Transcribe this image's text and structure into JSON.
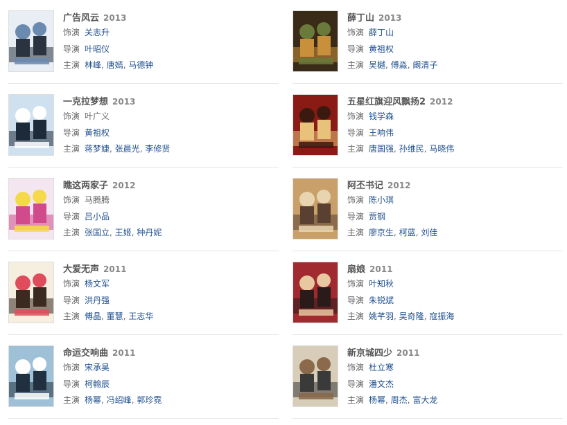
{
  "labels": {
    "role": "饰演",
    "director": "导演",
    "cast": "主演"
  },
  "left": [
    {
      "title": "广告风云",
      "year": "2013",
      "role": "关志升",
      "role_link": true,
      "director": "叶昭仪",
      "cast": [
        "林峰",
        "唐嫣",
        "马德钟"
      ],
      "poster": {
        "bg": "#e8eef3",
        "accent": "#2a3440",
        "hl": "#6a8ab0"
      }
    },
    {
      "title": "一克拉梦想",
      "year": "2013",
      "role": "叶广义",
      "role_link": false,
      "director": "黄祖权",
      "cast": [
        "蒋梦婕",
        "张晨光",
        "李修贤"
      ],
      "poster": {
        "bg": "#cfe0ee",
        "accent": "#1d2a3a",
        "hl": "#ffffff"
      }
    },
    {
      "title": "瞧这两家子",
      "year": "2012",
      "role": "马腾腾",
      "role_link": false,
      "director": "吕小品",
      "cast": [
        "张国立",
        "王姬",
        "种丹妮"
      ],
      "poster": {
        "bg": "#f3e6f0",
        "accent": "#d14b8c",
        "hl": "#f6d94b"
      }
    },
    {
      "title": "大爱无声",
      "year": "2011",
      "role": "杨文军",
      "role_link": true,
      "director": "洪丹强",
      "cast": [
        "傅晶",
        "董慧",
        "王志华"
      ],
      "poster": {
        "bg": "#f6efe0",
        "accent": "#3a2a20",
        "hl": "#e04c5c"
      }
    },
    {
      "title": "命运交响曲",
      "year": "2011",
      "role": "宋承昊",
      "role_link": true,
      "director": "柯翰辰",
      "cast": [
        "杨幂",
        "冯绍峰",
        "郭珍霓"
      ],
      "poster": {
        "bg": "#9fc1d8",
        "accent": "#203040",
        "hl": "#ffffff"
      }
    }
  ],
  "right": [
    {
      "title": "薛丁山",
      "year": "2013",
      "role": "薛丁山",
      "role_link": true,
      "director": "黄祖权",
      "cast": [
        "吴樾",
        "傅淼",
        "阚清子"
      ],
      "poster": {
        "bg": "#3a2a18",
        "accent": "#c8903a",
        "hl": "#6a7a3a"
      }
    },
    {
      "title": "五星红旗迎风飘扬2",
      "year": "2012",
      "role": "钱学森",
      "role_link": true,
      "director": "王响伟",
      "cast": [
        "唐国强",
        "孙维民",
        "马晓伟"
      ],
      "poster": {
        "bg": "#8a1a14",
        "accent": "#e8c27a",
        "hl": "#3a1a10"
      }
    },
    {
      "title": "阿丕书记",
      "year": "2012",
      "role": "陈小琪",
      "role_link": true,
      "director": "贾钢",
      "cast": [
        "廖京生",
        "柯蓝",
        "刘佳"
      ],
      "poster": {
        "bg": "#c9a06a",
        "accent": "#5a4030",
        "hl": "#e8d5b0"
      }
    },
    {
      "title": "扇娘",
      "year": "2011",
      "role": "叶知秋",
      "role_link": true,
      "director": "朱锐斌",
      "cast": [
        "姚芊羽",
        "吴奇隆",
        "寇振海"
      ],
      "poster": {
        "bg": "#a02a30",
        "accent": "#2a1a1a",
        "hl": "#e8c8a0"
      }
    },
    {
      "title": "新京城四少",
      "year": "2011",
      "role": "杜立寒",
      "role_link": true,
      "director": "潘文杰",
      "cast": [
        "杨幂",
        "周杰",
        "富大龙"
      ],
      "poster": {
        "bg": "#d8cdb8",
        "accent": "#3a3a3a",
        "hl": "#8a6a4a"
      }
    }
  ]
}
